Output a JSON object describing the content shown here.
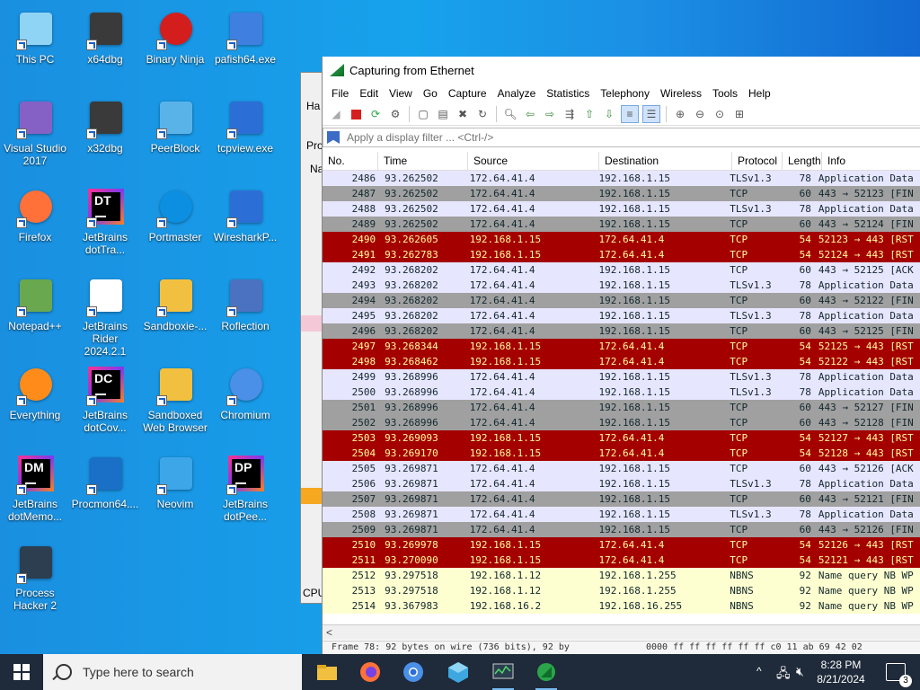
{
  "desktop": {
    "icons": [
      {
        "label": "This PC",
        "icon": "computer-icon"
      },
      {
        "label": "x64dbg",
        "icon": "bug-icon"
      },
      {
        "label": "Binary Ninja",
        "icon": "ninja-icon"
      },
      {
        "label": "pafish64.exe",
        "icon": "fish-icon"
      },
      {
        "label": "Visual Studio 2017",
        "icon": "visual-studio-icon"
      },
      {
        "label": "x32dbg",
        "icon": "bug-icon"
      },
      {
        "label": "PeerBlock",
        "icon": "cube-icon"
      },
      {
        "label": "tcpview.exe",
        "icon": "network-icon"
      },
      {
        "label": "Firefox",
        "icon": "firefox-icon"
      },
      {
        "label": "JetBrains dotTra...",
        "icon": "jetbrains-icon"
      },
      {
        "label": "Portmaster",
        "icon": "portmaster-icon"
      },
      {
        "label": "WiresharkP...",
        "icon": "wireshark-fin-icon"
      },
      {
        "label": "Notepad++",
        "icon": "notepad-icon"
      },
      {
        "label": "JetBrains Rider 2024.2.1",
        "icon": "document-icon"
      },
      {
        "label": "Sandboxie-...",
        "icon": "sandbox-icon"
      },
      {
        "label": "Roflection",
        "icon": "roflection-icon"
      },
      {
        "label": "Everything",
        "icon": "search-everything-icon"
      },
      {
        "label": "JetBrains dotCov...",
        "icon": "jetbrains-icon"
      },
      {
        "label": "Sandboxed Web Browser",
        "icon": "sandbox-icon"
      },
      {
        "label": "Chromium",
        "icon": "chromium-icon"
      },
      {
        "label": "JetBrains dotMemo...",
        "icon": "jetbrains-icon"
      },
      {
        "label": "Procmon64....",
        "icon": "procmon-icon"
      },
      {
        "label": "Neovim",
        "icon": "neovim-icon"
      },
      {
        "label": "JetBrains dotPee...",
        "icon": "jetbrains-icon"
      },
      {
        "label": "Process Hacker 2",
        "icon": "process-hacker-icon"
      }
    ],
    "jb_codes": {
      "dottrace": "DT",
      "dotcover": "DC",
      "dotmemory": "DM",
      "dotpeek": "DP"
    }
  },
  "bg_window": {
    "frag_ha": "Ha",
    "frag_pro": "Pro",
    "frag_na": "Na",
    "frag_cpu": "CPU"
  },
  "wireshark": {
    "title": "Capturing from Ethernet",
    "menu": [
      "File",
      "Edit",
      "View",
      "Go",
      "Capture",
      "Analyze",
      "Statistics",
      "Telephony",
      "Wireless",
      "Tools",
      "Help"
    ],
    "filter_placeholder": "Apply a display filter ... <Ctrl-/>",
    "columns": [
      "No.",
      "Time",
      "Source",
      "Destination",
      "Protocol",
      "Length",
      "Info"
    ],
    "packets": [
      {
        "no": "2486",
        "time": "93.262502",
        "src": "172.64.41.4",
        "dst": "192.168.1.15",
        "proto": "TLSv1.3",
        "len": "78",
        "info": "Application Data",
        "type": "tls"
      },
      {
        "no": "2487",
        "time": "93.262502",
        "src": "172.64.41.4",
        "dst": "192.168.1.15",
        "proto": "TCP",
        "len": "60",
        "info": "443 → 52123 [FIN",
        "type": "fin"
      },
      {
        "no": "2488",
        "time": "93.262502",
        "src": "172.64.41.4",
        "dst": "192.168.1.15",
        "proto": "TLSv1.3",
        "len": "78",
        "info": "Application Data",
        "type": "tls"
      },
      {
        "no": "2489",
        "time": "93.262502",
        "src": "172.64.41.4",
        "dst": "192.168.1.15",
        "proto": "TCP",
        "len": "60",
        "info": "443 → 52124 [FIN",
        "type": "fin"
      },
      {
        "no": "2490",
        "time": "93.262605",
        "src": "192.168.1.15",
        "dst": "172.64.41.4",
        "proto": "TCP",
        "len": "54",
        "info": "52123 → 443 [RST",
        "type": "rst"
      },
      {
        "no": "2491",
        "time": "93.262783",
        "src": "192.168.1.15",
        "dst": "172.64.41.4",
        "proto": "TCP",
        "len": "54",
        "info": "52124 → 443 [RST",
        "type": "rst"
      },
      {
        "no": "2492",
        "time": "93.268202",
        "src": "172.64.41.4",
        "dst": "192.168.1.15",
        "proto": "TCP",
        "len": "60",
        "info": "443 → 52125 [ACK",
        "type": "tcp"
      },
      {
        "no": "2493",
        "time": "93.268202",
        "src": "172.64.41.4",
        "dst": "192.168.1.15",
        "proto": "TLSv1.3",
        "len": "78",
        "info": "Application Data",
        "type": "tls"
      },
      {
        "no": "2494",
        "time": "93.268202",
        "src": "172.64.41.4",
        "dst": "192.168.1.15",
        "proto": "TCP",
        "len": "60",
        "info": "443 → 52122 [FIN",
        "type": "fin"
      },
      {
        "no": "2495",
        "time": "93.268202",
        "src": "172.64.41.4",
        "dst": "192.168.1.15",
        "proto": "TLSv1.3",
        "len": "78",
        "info": "Application Data",
        "type": "tls"
      },
      {
        "no": "2496",
        "time": "93.268202",
        "src": "172.64.41.4",
        "dst": "192.168.1.15",
        "proto": "TCP",
        "len": "60",
        "info": "443 → 52125 [FIN",
        "type": "fin"
      },
      {
        "no": "2497",
        "time": "93.268344",
        "src": "192.168.1.15",
        "dst": "172.64.41.4",
        "proto": "TCP",
        "len": "54",
        "info": "52125 → 443 [RST",
        "type": "rst"
      },
      {
        "no": "2498",
        "time": "93.268462",
        "src": "192.168.1.15",
        "dst": "172.64.41.4",
        "proto": "TCP",
        "len": "54",
        "info": "52122 → 443 [RST",
        "type": "rst"
      },
      {
        "no": "2499",
        "time": "93.268996",
        "src": "172.64.41.4",
        "dst": "192.168.1.15",
        "proto": "TLSv1.3",
        "len": "78",
        "info": "Application Data",
        "type": "tls"
      },
      {
        "no": "2500",
        "time": "93.268996",
        "src": "172.64.41.4",
        "dst": "192.168.1.15",
        "proto": "TLSv1.3",
        "len": "78",
        "info": "Application Data",
        "type": "tls"
      },
      {
        "no": "2501",
        "time": "93.268996",
        "src": "172.64.41.4",
        "dst": "192.168.1.15",
        "proto": "TCP",
        "len": "60",
        "info": "443 → 52127 [FIN",
        "type": "fin"
      },
      {
        "no": "2502",
        "time": "93.268996",
        "src": "172.64.41.4",
        "dst": "192.168.1.15",
        "proto": "TCP",
        "len": "60",
        "info": "443 → 52128 [FIN",
        "type": "fin"
      },
      {
        "no": "2503",
        "time": "93.269093",
        "src": "192.168.1.15",
        "dst": "172.64.41.4",
        "proto": "TCP",
        "len": "54",
        "info": "52127 → 443 [RST",
        "type": "rst"
      },
      {
        "no": "2504",
        "time": "93.269170",
        "src": "192.168.1.15",
        "dst": "172.64.41.4",
        "proto": "TCP",
        "len": "54",
        "info": "52128 → 443 [RST",
        "type": "rst"
      },
      {
        "no": "2505",
        "time": "93.269871",
        "src": "172.64.41.4",
        "dst": "192.168.1.15",
        "proto": "TCP",
        "len": "60",
        "info": "443 → 52126 [ACK",
        "type": "tcp"
      },
      {
        "no": "2506",
        "time": "93.269871",
        "src": "172.64.41.4",
        "dst": "192.168.1.15",
        "proto": "TLSv1.3",
        "len": "78",
        "info": "Application Data",
        "type": "tls"
      },
      {
        "no": "2507",
        "time": "93.269871",
        "src": "172.64.41.4",
        "dst": "192.168.1.15",
        "proto": "TCP",
        "len": "60",
        "info": "443 → 52121 [FIN",
        "type": "fin"
      },
      {
        "no": "2508",
        "time": "93.269871",
        "src": "172.64.41.4",
        "dst": "192.168.1.15",
        "proto": "TLSv1.3",
        "len": "78",
        "info": "Application Data",
        "type": "tls"
      },
      {
        "no": "2509",
        "time": "93.269871",
        "src": "172.64.41.4",
        "dst": "192.168.1.15",
        "proto": "TCP",
        "len": "60",
        "info": "443 → 52126 [FIN",
        "type": "fin"
      },
      {
        "no": "2510",
        "time": "93.269978",
        "src": "192.168.1.15",
        "dst": "172.64.41.4",
        "proto": "TCP",
        "len": "54",
        "info": "52126 → 443 [RST",
        "type": "rst"
      },
      {
        "no": "2511",
        "time": "93.270090",
        "src": "192.168.1.15",
        "dst": "172.64.41.4",
        "proto": "TCP",
        "len": "54",
        "info": "52121 → 443 [RST",
        "type": "rst"
      },
      {
        "no": "2512",
        "time": "93.297518",
        "src": "192.168.1.12",
        "dst": "192.168.1.255",
        "proto": "NBNS",
        "len": "92",
        "info": "Name query NB WP",
        "type": "nbns"
      },
      {
        "no": "2513",
        "time": "93.297518",
        "src": "192.168.1.12",
        "dst": "192.168.1.255",
        "proto": "NBNS",
        "len": "92",
        "info": "Name query NB WP",
        "type": "nbns"
      },
      {
        "no": "2514",
        "time": "93.367983",
        "src": "192.168.16.2",
        "dst": "192.168.16.255",
        "proto": "NBNS",
        "len": "92",
        "info": "Name query NB WP",
        "type": "nbns"
      }
    ],
    "details_left": "Frame 78: 92 bytes on wire (736 bits), 92 by",
    "details_right": "0000  ff ff ff ff ff ff c0 11  ab 69 42 02",
    "colors": {
      "tls": "#e7e6ff",
      "tcp": "#e7e6ff",
      "fin": "#a0a0a0",
      "rst": "#a40000",
      "rst_text": "#fffc9c",
      "nbns": "#feffd0"
    }
  },
  "taskbar": {
    "search_placeholder": "Type here to search",
    "time": "8:28 PM",
    "date": "8/21/2024",
    "notifications": "3",
    "apps": [
      "file-explorer-icon",
      "firefox-icon",
      "chromium-icon",
      "virtualbox-icon",
      "process-hacker-icon",
      "wireshark-icon"
    ]
  }
}
